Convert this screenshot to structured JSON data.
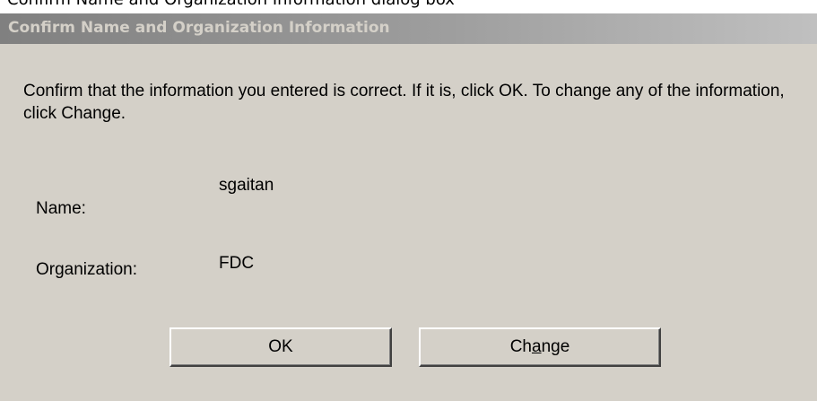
{
  "top_strip": {
    "text": "Confirm Name and Organization Information dialog box"
  },
  "dialog": {
    "title": "Confirm Name and Organization Information",
    "message": "Confirm that the information you entered is correct. If it is, click OK. To change any of the information, click Change.",
    "name_label": "Name:",
    "name_value": "sgaitan",
    "org_label": "Organization:",
    "org_value": "FDC",
    "ok_label": "OK",
    "change_label_pre": "Ch",
    "change_label_mnemonic": "a",
    "change_label_post": "nge"
  },
  "colors": {
    "dialog_face": "#d4d0c8",
    "title_gradient_start": "#808080",
    "title_gradient_end": "#c0c0c0"
  }
}
